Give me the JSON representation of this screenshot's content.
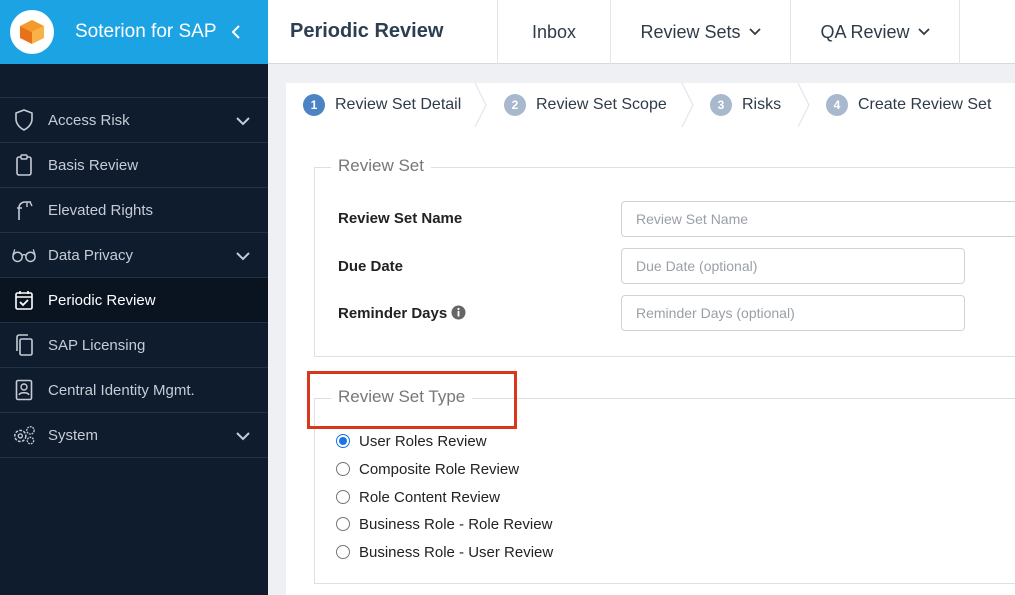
{
  "sidebar": {
    "brand_title": "Soterion for SAP",
    "items": [
      {
        "label": "Access Risk",
        "icon": "shield-icon",
        "has_chevron": true
      },
      {
        "label": "Basis Review",
        "icon": "clipboard-icon",
        "has_chevron": false
      },
      {
        "label": "Elevated Rights",
        "icon": "firefighter-icon",
        "has_chevron": false
      },
      {
        "label": "Data Privacy",
        "icon": "glasses-icon",
        "has_chevron": true
      },
      {
        "label": "Periodic Review",
        "icon": "calendar-check-icon",
        "has_chevron": false,
        "active": true
      },
      {
        "label": "SAP Licensing",
        "icon": "copy-icon",
        "has_chevron": false
      },
      {
        "label": "Central Identity Mgmt.",
        "icon": "id-card-icon",
        "has_chevron": false
      },
      {
        "label": "System",
        "icon": "gears-icon",
        "has_chevron": true
      }
    ]
  },
  "topbar": {
    "title": "Periodic Review",
    "tabs": [
      {
        "label": "Inbox"
      },
      {
        "label": "Review Sets"
      },
      {
        "label": "QA Review"
      }
    ]
  },
  "wizard": {
    "steps": [
      {
        "num": "1",
        "label": "Review Set Detail",
        "active": true
      },
      {
        "num": "2",
        "label": "Review Set Scope"
      },
      {
        "num": "3",
        "label": "Risks"
      },
      {
        "num": "4",
        "label": "Create Review Set"
      }
    ]
  },
  "review_set": {
    "legend": "Review Set",
    "name_label": "Review Set Name",
    "name_placeholder": "Review Set Name",
    "due_label": "Due Date",
    "due_placeholder": "Due Date (optional)",
    "reminder_label": "Reminder Days",
    "reminder_placeholder": "Reminder Days (optional)"
  },
  "review_set_type": {
    "legend": "Review Set Type",
    "options": [
      {
        "label": "User Roles Review",
        "checked": true
      },
      {
        "label": "Composite Role Review"
      },
      {
        "label": "Role Content Review"
      },
      {
        "label": "Business Role - Role Review"
      },
      {
        "label": "Business Role - User Review"
      }
    ]
  },
  "colors": {
    "brand": "#1ba3e4",
    "sidebar_bg": "#0f1c2e",
    "highlight": "#d9361e",
    "step_active": "#4b83c4"
  }
}
